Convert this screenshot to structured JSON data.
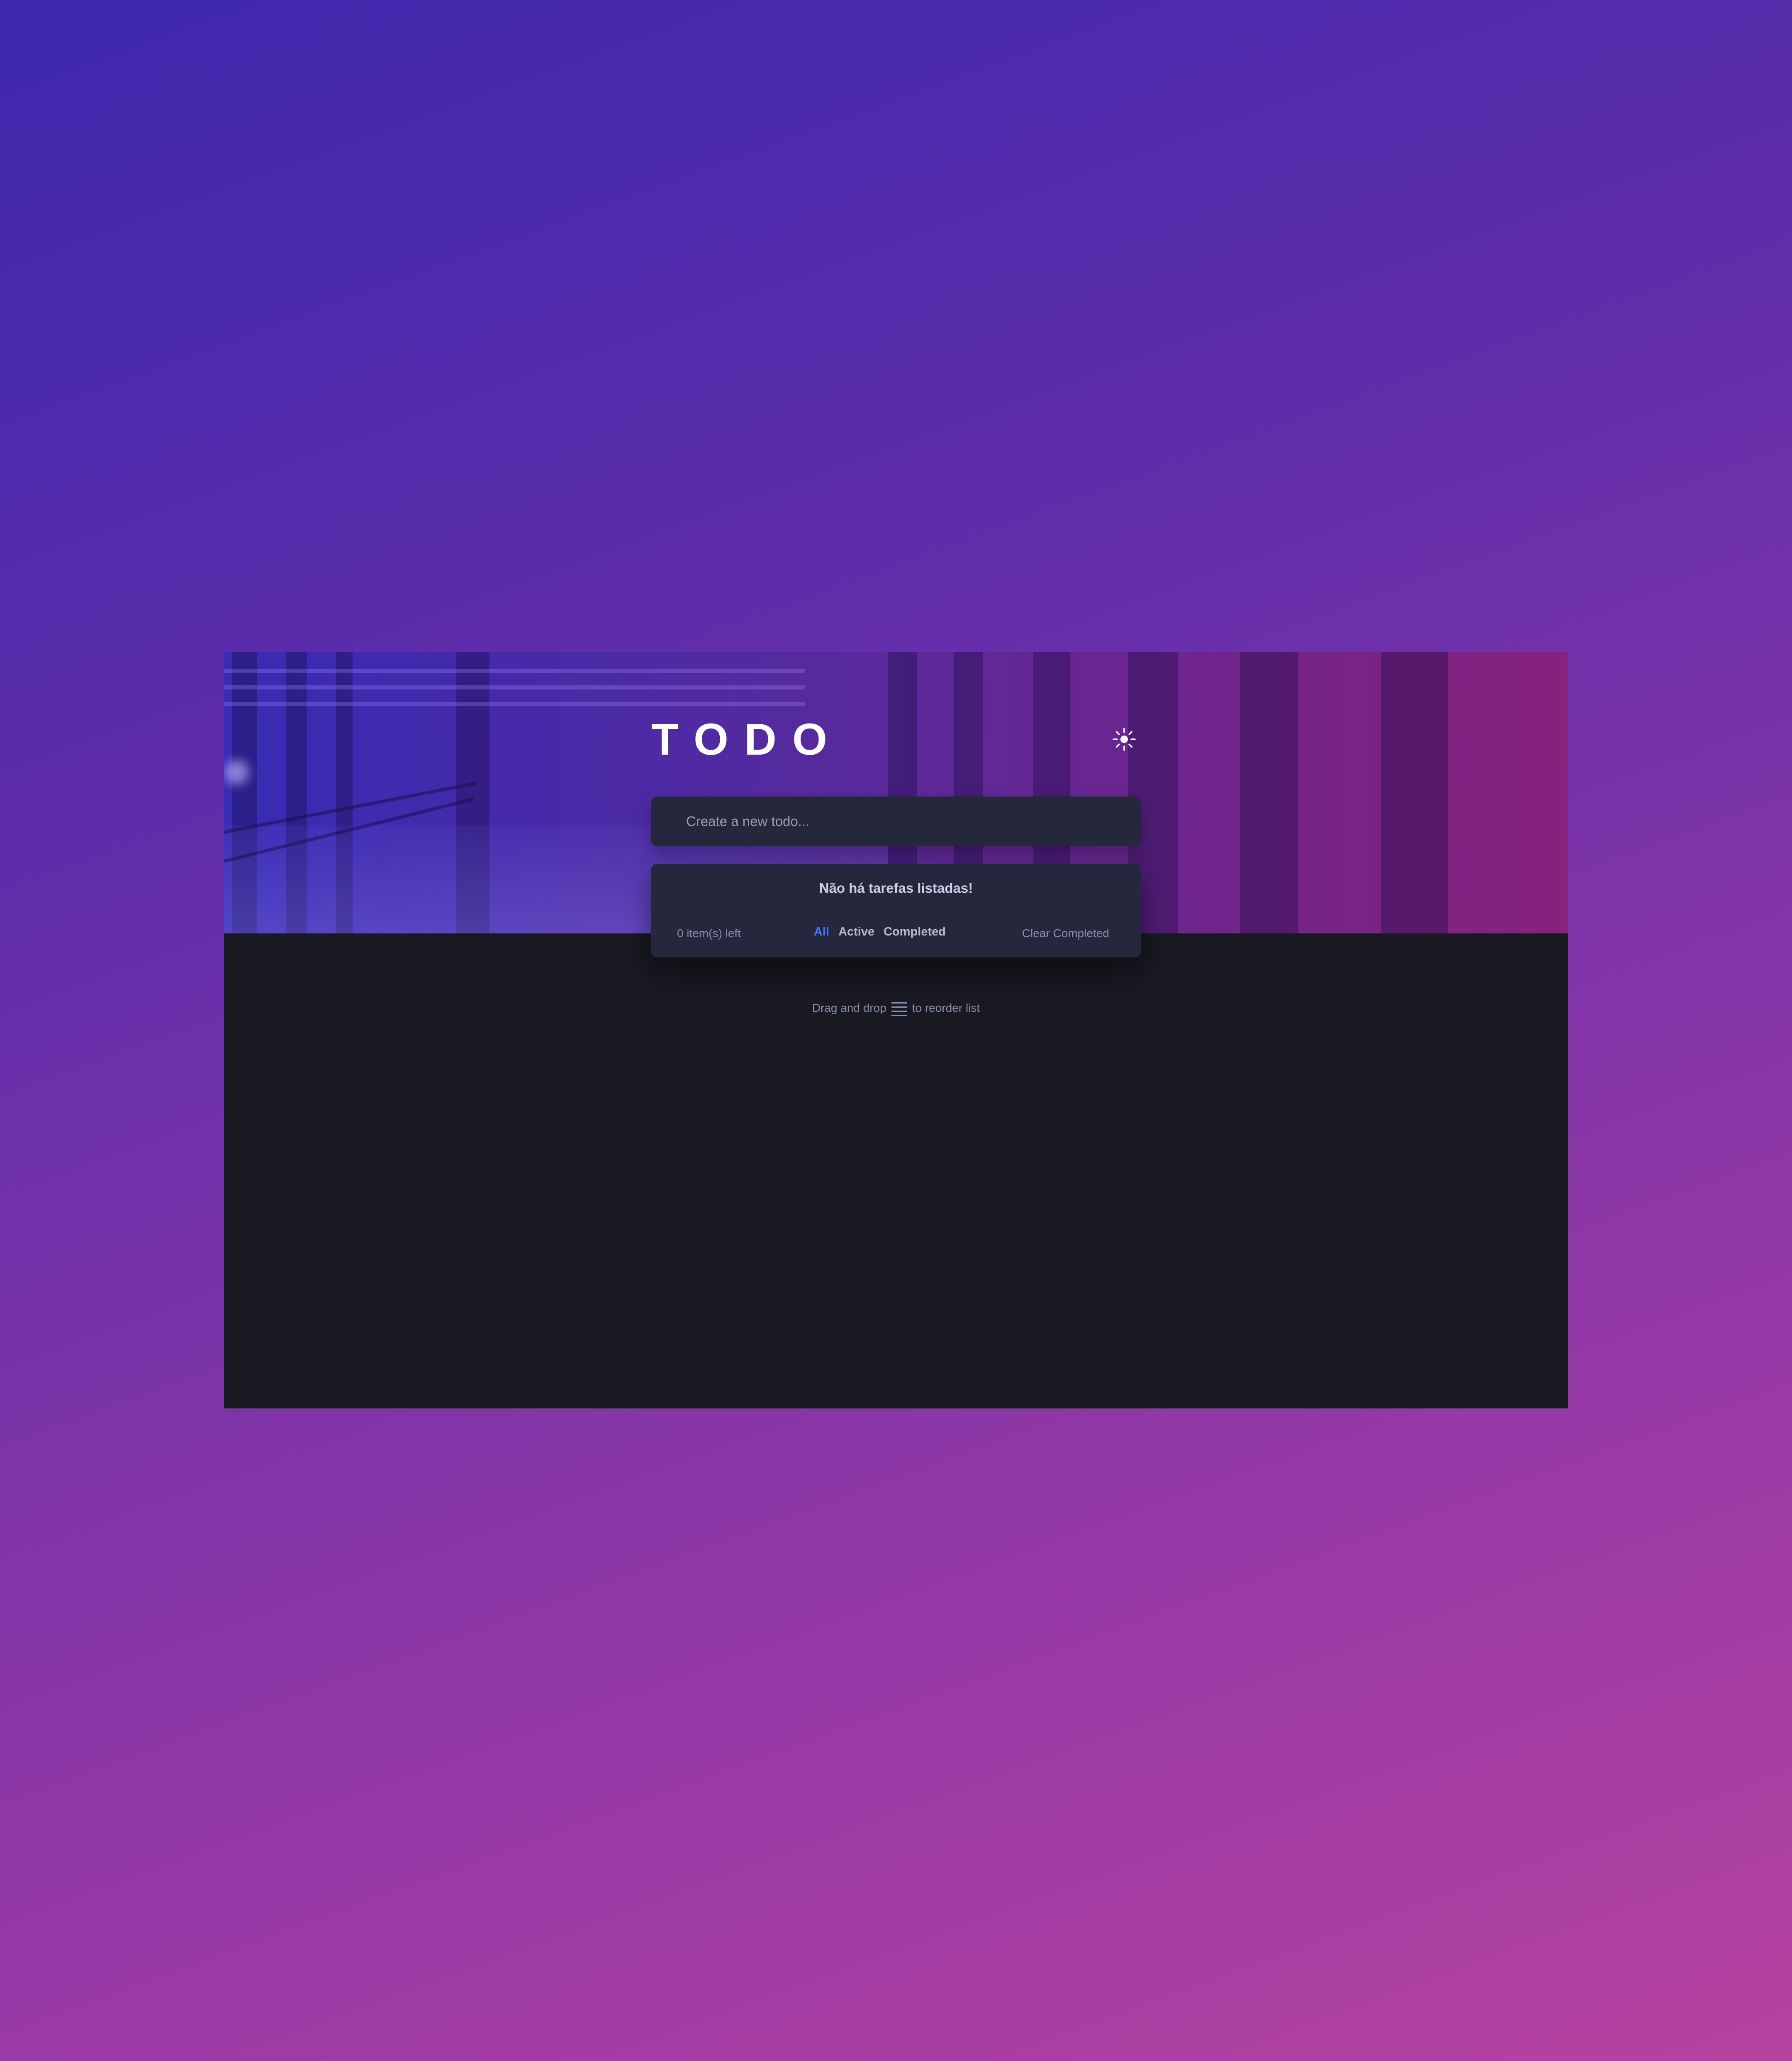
{
  "app": {
    "title": "TODO"
  },
  "header": {
    "theme_toggle_icon": "sun-icon"
  },
  "new_todo": {
    "placeholder": "Create a new todo..."
  },
  "list": {
    "empty_message": "Não há tarefas listadas!",
    "items_left": "0 item(s) left",
    "filters": [
      {
        "label": "All",
        "active": true
      },
      {
        "label": "Active",
        "active": false
      },
      {
        "label": "Completed",
        "active": false
      }
    ],
    "clear_completed": "Clear Completed"
  },
  "hint": {
    "before": "Drag and drop",
    "icon": "drag-handle-icon",
    "after": "to reorder list"
  },
  "colors": {
    "card_bg": "#25273c",
    "page_bg": "#181921",
    "active_filter": "#3a7cfd",
    "muted_text": "#8a8db0"
  }
}
